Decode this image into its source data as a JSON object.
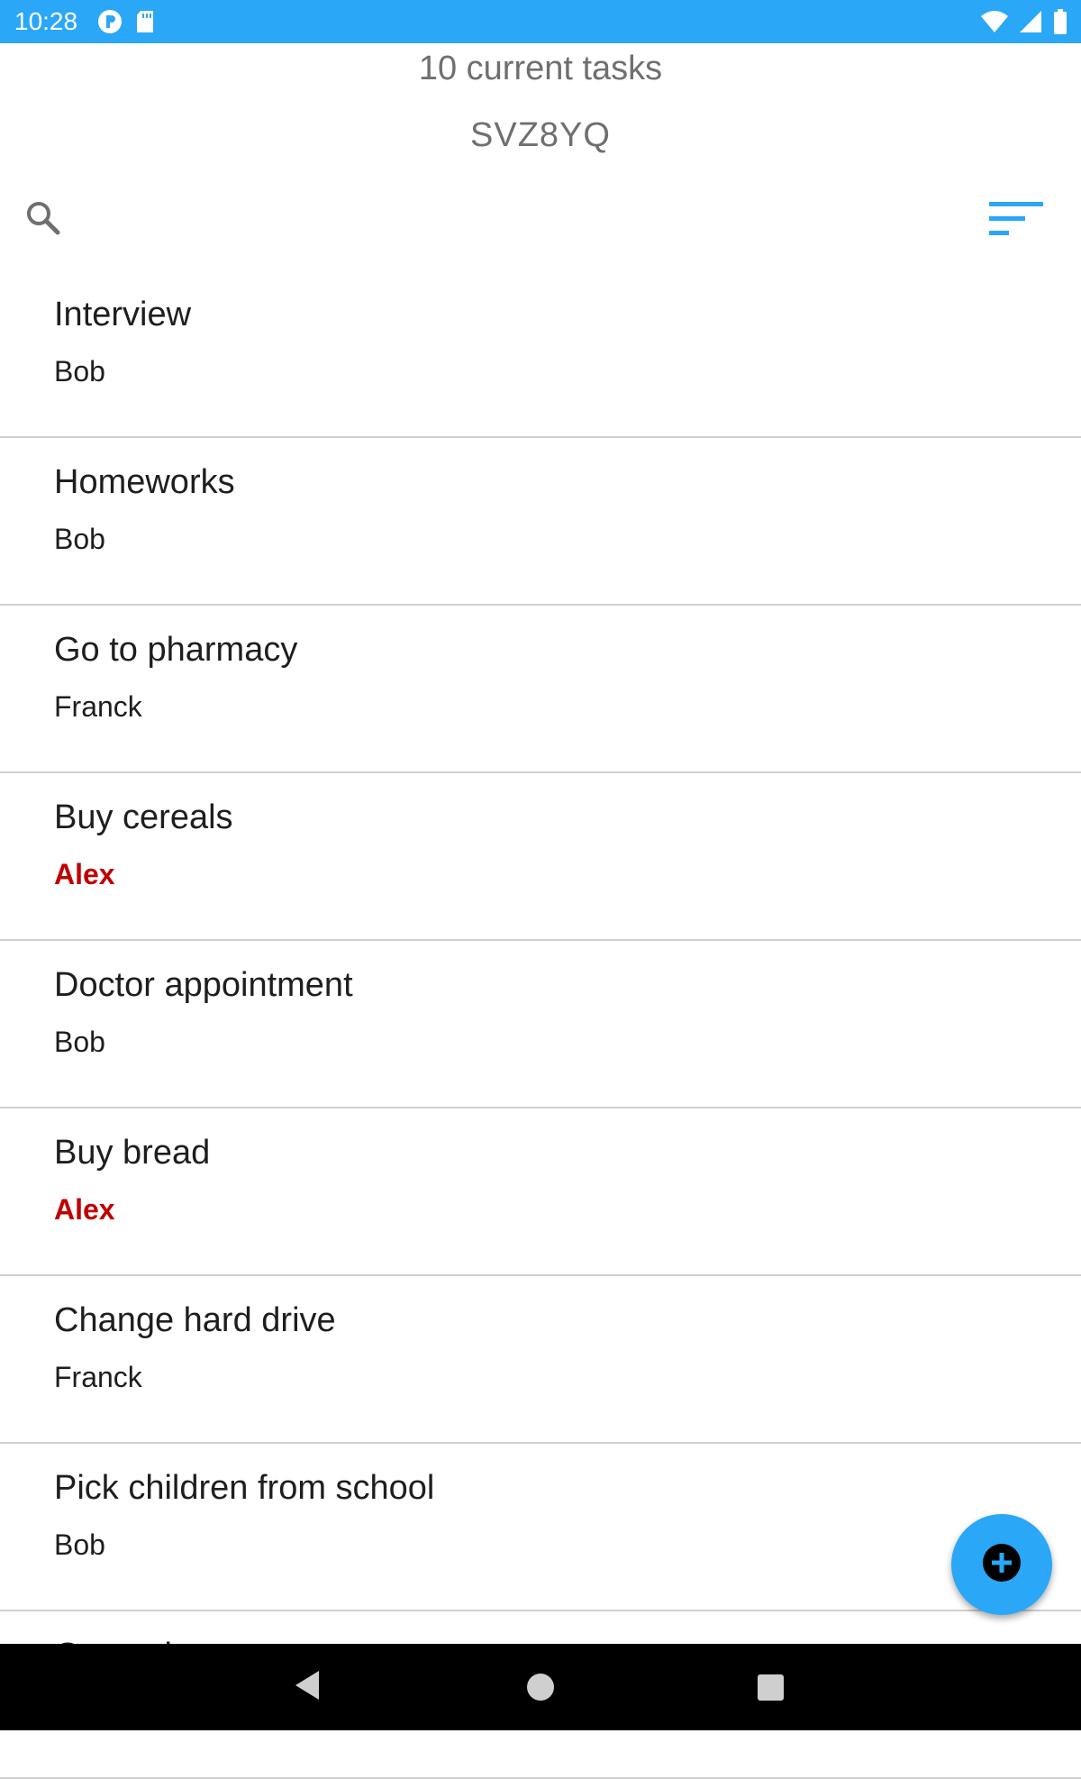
{
  "status_bar": {
    "time": "10:28",
    "left_icons": [
      "notification-app-icon",
      "sd-card-icon"
    ],
    "right_icons": [
      "wifi-icon",
      "cell-signal-icon",
      "battery-icon"
    ],
    "background_color": "#2aa7f7"
  },
  "header": {
    "task_count_label": "10 current tasks",
    "list_code": "SVZ8YQ"
  },
  "toolbar": {
    "search_icon": "search-icon",
    "sort_icon": "sort-icon",
    "accent_color": "#2aa7f7"
  },
  "tasks": [
    {
      "title": "Interview",
      "assignee": "Bob",
      "highlight": false
    },
    {
      "title": "Homeworks",
      "assignee": "Bob",
      "highlight": false
    },
    {
      "title": "Go to pharmacy",
      "assignee": "Franck",
      "highlight": false
    },
    {
      "title": "Buy cereals",
      "assignee": "Alex",
      "highlight": true
    },
    {
      "title": "Doctor appointment",
      "assignee": "Bob",
      "highlight": false
    },
    {
      "title": "Buy bread",
      "assignee": "Alex",
      "highlight": true
    },
    {
      "title": "Change hard drive",
      "assignee": "Franck",
      "highlight": false
    },
    {
      "title": "Pick children from school",
      "assignee": "Bob",
      "highlight": false
    },
    {
      "title": "Go to cinema",
      "assignee": "",
      "highlight": false
    }
  ],
  "highlight_color": "#c00000",
  "fab": {
    "icon": "add-circle-icon",
    "color": "#2aa7f7"
  },
  "nav_bar": {
    "icons": [
      "back-icon",
      "home-icon",
      "recents-icon"
    ]
  }
}
